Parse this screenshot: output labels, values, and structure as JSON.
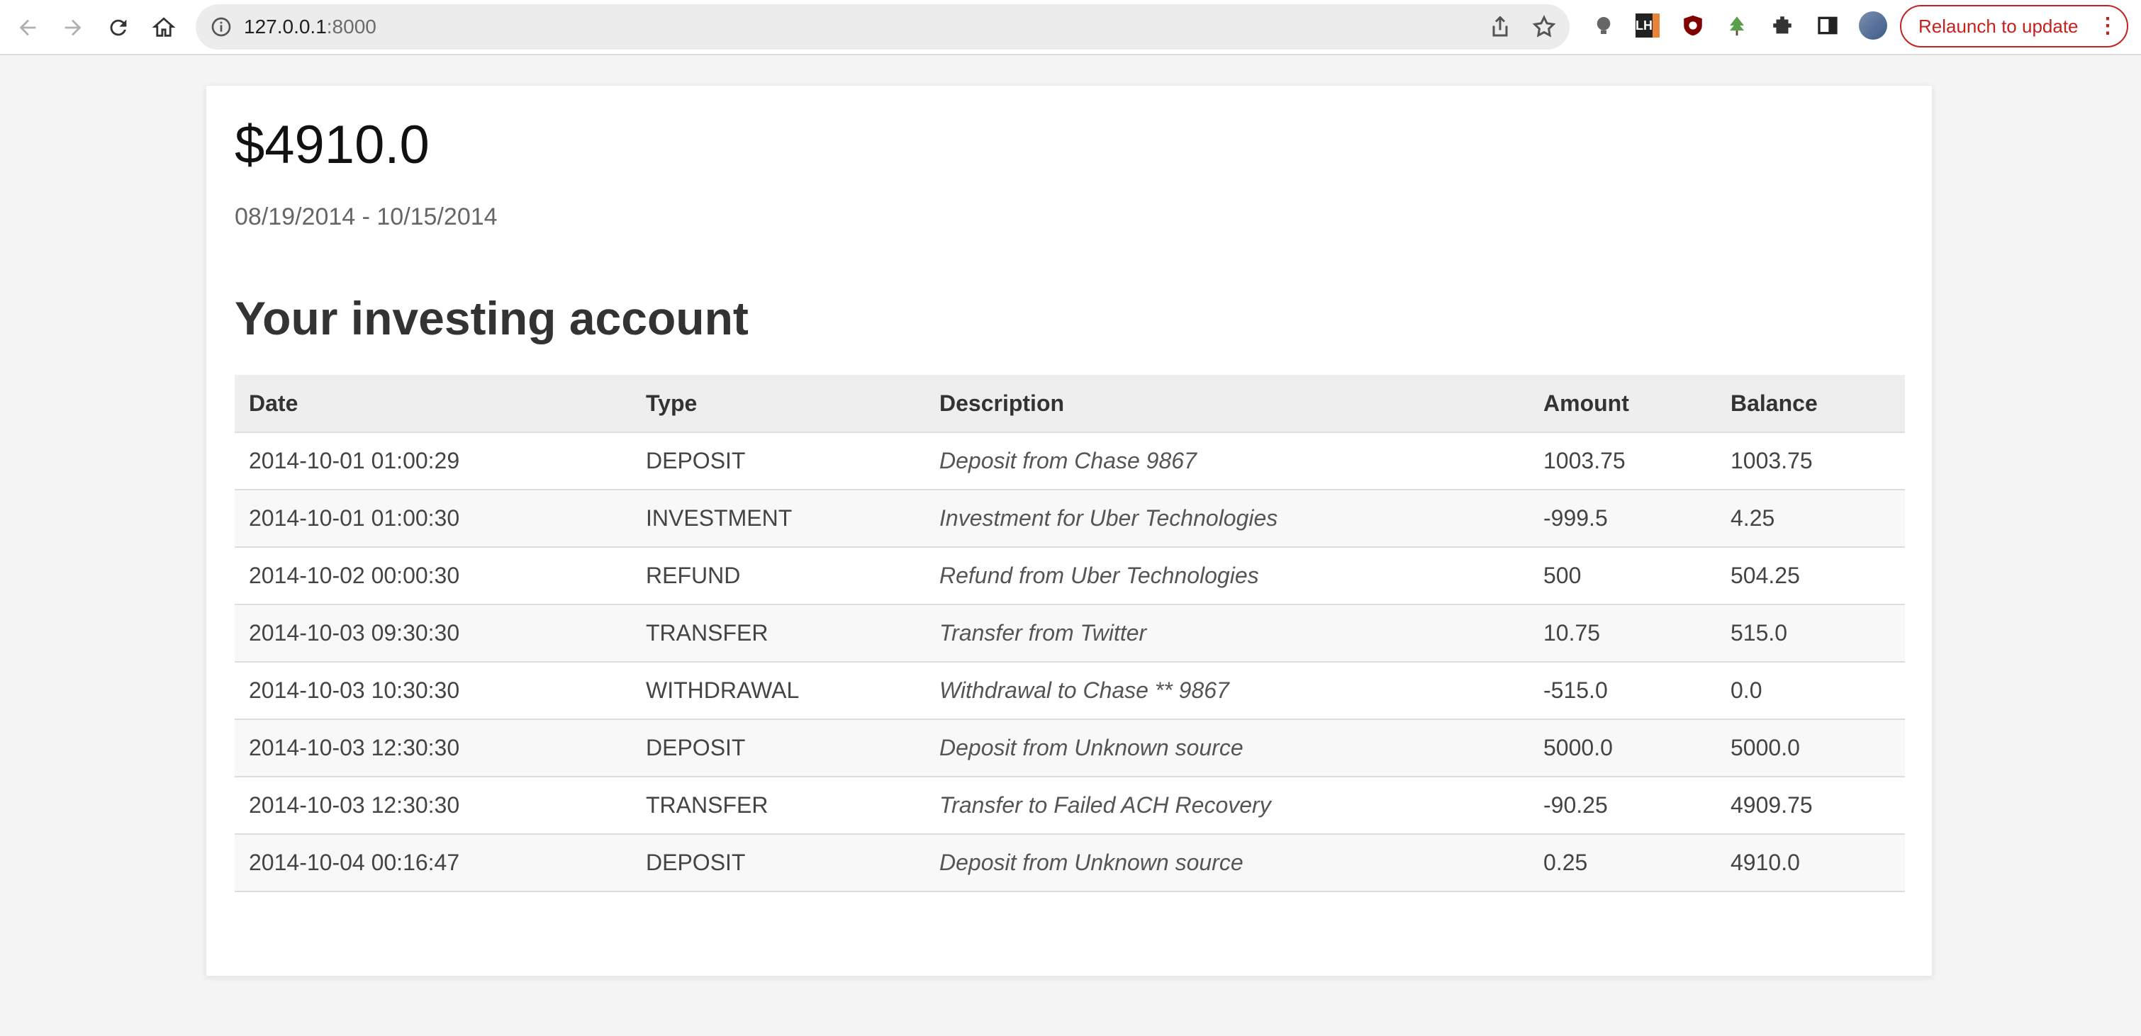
{
  "browser": {
    "url_host": "127.0.0.1",
    "url_port": ":8000",
    "relaunch_label": "Relaunch to update",
    "extension_lh_label": "LH"
  },
  "account": {
    "total": "$4910.0",
    "date_range": "08/19/2014 - 10/15/2014",
    "heading": "Your investing account"
  },
  "table": {
    "headers": [
      "Date",
      "Type",
      "Description",
      "Amount",
      "Balance"
    ],
    "rows": [
      {
        "date": "2014-10-01 01:00:29",
        "type": "DEPOSIT",
        "description": "Deposit from Chase 9867",
        "amount": "1003.75",
        "balance": "1003.75"
      },
      {
        "date": "2014-10-01 01:00:30",
        "type": "INVESTMENT",
        "description": "Investment for Uber Technologies",
        "amount": "-999.5",
        "balance": "4.25"
      },
      {
        "date": "2014-10-02 00:00:30",
        "type": "REFUND",
        "description": "Refund from Uber Technologies",
        "amount": "500",
        "balance": "504.25"
      },
      {
        "date": "2014-10-03 09:30:30",
        "type": "TRANSFER",
        "description": "Transfer from Twitter",
        "amount": "10.75",
        "balance": "515.0"
      },
      {
        "date": "2014-10-03 10:30:30",
        "type": "WITHDRAWAL",
        "description": "Withdrawal to Chase ** 9867",
        "amount": "-515.0",
        "balance": "0.0"
      },
      {
        "date": "2014-10-03 12:30:30",
        "type": "DEPOSIT",
        "description": "Deposit from Unknown source",
        "amount": "5000.0",
        "balance": "5000.0"
      },
      {
        "date": "2014-10-03 12:30:30",
        "type": "TRANSFER",
        "description": "Transfer to Failed ACH Recovery",
        "amount": "-90.25",
        "balance": "4909.75"
      },
      {
        "date": "2014-10-04 00:16:47",
        "type": "DEPOSIT",
        "description": "Deposit from Unknown source",
        "amount": "0.25",
        "balance": "4910.0"
      }
    ]
  },
  "colors": {
    "relaunch_accent": "#c5221f",
    "header_bg": "#eeeeee",
    "page_bg": "#f4f4f4"
  }
}
